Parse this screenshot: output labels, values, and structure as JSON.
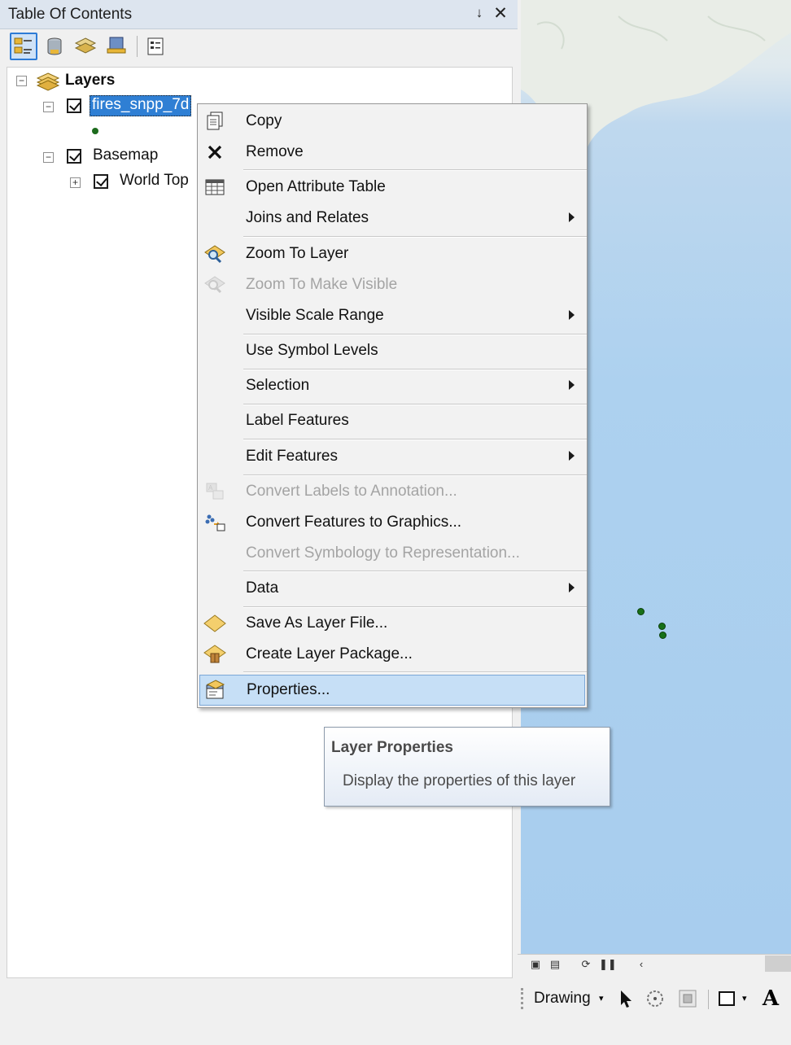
{
  "toc": {
    "title": "Table Of Contents",
    "pin_glyph": "↓",
    "close_glyph": "✕",
    "toolbar": [
      {
        "icon": "list-by-drawing-order-icon"
      },
      {
        "icon": "list-by-source-icon"
      },
      {
        "icon": "list-by-visibility-icon"
      },
      {
        "icon": "list-by-selection-icon"
      },
      {
        "icon": "options-icon"
      }
    ],
    "tree": {
      "root_label": "Layers",
      "layers": [
        {
          "label": "fires_snpp_7d",
          "selected": true
        },
        {
          "label": "Basemap",
          "selected": false
        },
        {
          "label": "World Top",
          "selected": false
        }
      ]
    }
  },
  "context_menu": {
    "items": [
      {
        "label": "Copy",
        "icon": "copy-icon",
        "enabled": true,
        "submenu": false
      },
      {
        "label": "Remove",
        "icon": "remove-icon",
        "enabled": true,
        "submenu": false
      },
      {
        "label": "Open Attribute Table",
        "icon": "attribute-table-icon",
        "enabled": true,
        "submenu": false
      },
      {
        "label": "Joins and Relates",
        "icon": "",
        "enabled": true,
        "submenu": true
      },
      {
        "label": "Zoom To Layer",
        "icon": "zoom-to-layer-icon",
        "enabled": true,
        "submenu": false
      },
      {
        "label": "Zoom To Make Visible",
        "icon": "zoom-to-make-visible-icon",
        "enabled": false,
        "submenu": false
      },
      {
        "label": "Visible Scale Range",
        "icon": "",
        "enabled": true,
        "submenu": true
      },
      {
        "label": "Use Symbol Levels",
        "icon": "",
        "enabled": true,
        "submenu": false
      },
      {
        "label": "Selection",
        "icon": "",
        "enabled": true,
        "submenu": true
      },
      {
        "label": "Label Features",
        "icon": "",
        "enabled": true,
        "submenu": false
      },
      {
        "label": "Edit Features",
        "icon": "",
        "enabled": true,
        "submenu": true
      },
      {
        "label": "Convert Labels to Annotation...",
        "icon": "convert-labels-icon",
        "enabled": false,
        "submenu": false
      },
      {
        "label": "Convert Features to Graphics...",
        "icon": "convert-features-icon",
        "enabled": true,
        "submenu": false
      },
      {
        "label": "Convert Symbology to Representation...",
        "icon": "",
        "enabled": false,
        "submenu": false
      },
      {
        "label": "Data",
        "icon": "",
        "enabled": true,
        "submenu": true
      },
      {
        "label": "Save As Layer File...",
        "icon": "layer-file-icon",
        "enabled": true,
        "submenu": false
      },
      {
        "label": "Create Layer Package...",
        "icon": "layer-package-icon",
        "enabled": true,
        "submenu": false
      },
      {
        "label": "Properties...",
        "icon": "properties-icon",
        "enabled": true,
        "submenu": false,
        "highlighted": true
      }
    ]
  },
  "tooltip": {
    "title": "Layer Properties",
    "description": "Display the properties of this layer"
  },
  "drawing_toolbar": {
    "label": "Drawing",
    "tools": [
      {
        "icon": "select-elements-icon"
      },
      {
        "icon": "rotate-icon"
      },
      {
        "icon": "zoom-to-selected-elements-icon"
      },
      {
        "icon": "rectangle-icon"
      },
      {
        "icon": "text-icon",
        "glyph": "A"
      }
    ]
  },
  "colors": {
    "selection_blue": "#2f7fd4",
    "menu_highlight": "#c6dff6",
    "fire_point": "#177017",
    "ocean": "#a8cdee"
  }
}
